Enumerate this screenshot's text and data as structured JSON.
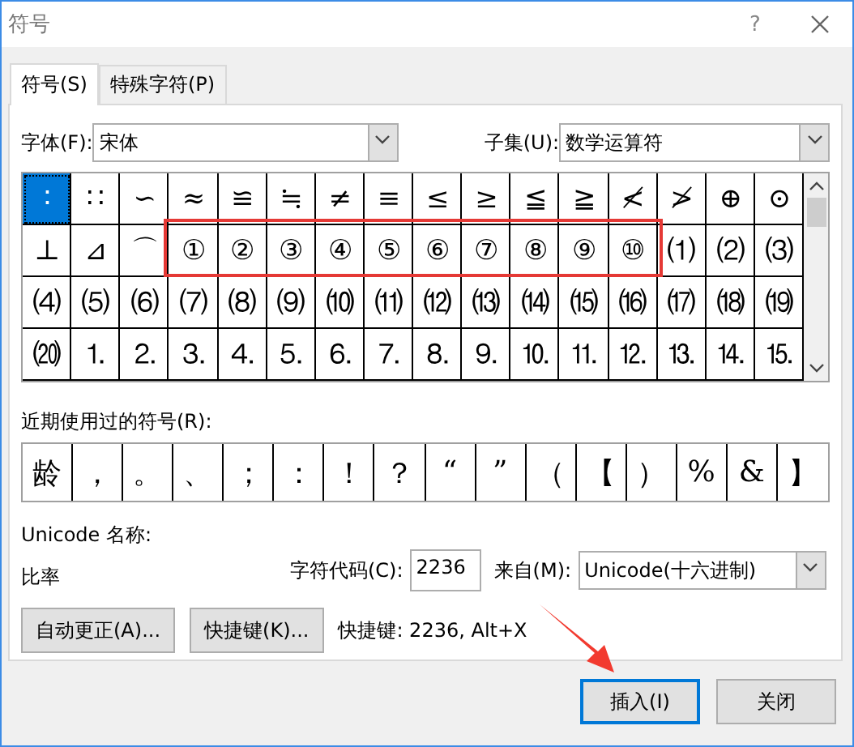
{
  "window": {
    "title": "符号",
    "help": "?"
  },
  "tabs": [
    {
      "label": "符号(S)",
      "selected": true
    },
    {
      "label": "特殊字符(P)",
      "selected": false
    }
  ],
  "font": {
    "label": "字体(F):",
    "value": "宋体"
  },
  "subset": {
    "label": "子集(U):",
    "value": "数学运算符"
  },
  "symbols": [
    [
      {
        "char": "∶",
        "selected": true
      },
      {
        "char": "∷",
        "selected": false
      },
      {
        "char": "∽",
        "selected": false
      },
      {
        "char": "≈",
        "selected": false
      },
      {
        "char": "≌",
        "selected": false
      },
      {
        "char": "≒",
        "selected": false
      },
      {
        "char": "≠",
        "selected": false
      },
      {
        "char": "≡",
        "selected": false
      },
      {
        "char": "≤",
        "selected": false
      },
      {
        "char": "≥",
        "selected": false
      },
      {
        "char": "≦",
        "selected": false
      },
      {
        "char": "≧",
        "selected": false
      },
      {
        "char": "≮",
        "selected": false
      },
      {
        "char": "≯",
        "selected": false
      },
      {
        "char": "⊕",
        "selected": false
      },
      {
        "char": "⊙",
        "selected": false
      }
    ],
    [
      {
        "char": "⊥",
        "selected": false
      },
      {
        "char": "⊿",
        "selected": false
      },
      {
        "char": "⌒",
        "selected": false
      },
      {
        "char": "①",
        "selected": false
      },
      {
        "char": "②",
        "selected": false
      },
      {
        "char": "③",
        "selected": false
      },
      {
        "char": "④",
        "selected": false
      },
      {
        "char": "⑤",
        "selected": false
      },
      {
        "char": "⑥",
        "selected": false
      },
      {
        "char": "⑦",
        "selected": false
      },
      {
        "char": "⑧",
        "selected": false
      },
      {
        "char": "⑨",
        "selected": false
      },
      {
        "char": "⑩",
        "selected": false
      },
      {
        "char": "⑴",
        "selected": false
      },
      {
        "char": "⑵",
        "selected": false
      },
      {
        "char": "⑶",
        "selected": false
      }
    ],
    [
      {
        "char": "⑷",
        "selected": false
      },
      {
        "char": "⑸",
        "selected": false
      },
      {
        "char": "⑹",
        "selected": false
      },
      {
        "char": "⑺",
        "selected": false
      },
      {
        "char": "⑻",
        "selected": false
      },
      {
        "char": "⑼",
        "selected": false
      },
      {
        "char": "⑽",
        "selected": false
      },
      {
        "char": "⑾",
        "selected": false
      },
      {
        "char": "⑿",
        "selected": false
      },
      {
        "char": "⒀",
        "selected": false
      },
      {
        "char": "⒁",
        "selected": false
      },
      {
        "char": "⒂",
        "selected": false
      },
      {
        "char": "⒃",
        "selected": false
      },
      {
        "char": "⒄",
        "selected": false
      },
      {
        "char": "⒅",
        "selected": false
      },
      {
        "char": "⒆",
        "selected": false
      }
    ],
    [
      {
        "char": "⒇",
        "selected": false
      },
      {
        "char": "⒈",
        "selected": false
      },
      {
        "char": "⒉",
        "selected": false
      },
      {
        "char": "⒊",
        "selected": false
      },
      {
        "char": "⒋",
        "selected": false
      },
      {
        "char": "⒌",
        "selected": false
      },
      {
        "char": "⒍",
        "selected": false
      },
      {
        "char": "⒎",
        "selected": false
      },
      {
        "char": "⒏",
        "selected": false
      },
      {
        "char": "⒐",
        "selected": false
      },
      {
        "char": "⒑",
        "selected": false
      },
      {
        "char": "⒒",
        "selected": false
      },
      {
        "char": "⒓",
        "selected": false
      },
      {
        "char": "⒔",
        "selected": false
      },
      {
        "char": "⒕",
        "selected": false
      },
      {
        "char": "⒖",
        "selected": false
      }
    ]
  ],
  "recent": {
    "label": "近期使用过的符号(R):",
    "symbols": [
      "龄",
      "，",
      "。",
      "、",
      "；",
      "：",
      "！",
      "？",
      "“",
      "”",
      "（",
      "【",
      "）",
      "%",
      "&",
      "】"
    ]
  },
  "unicode_name": {
    "label": "Unicode 名称:",
    "value": "比率"
  },
  "char_code": {
    "label": "字符代码(C):",
    "value": "2236"
  },
  "from": {
    "label": "来自(M):",
    "value": "Unicode(十六进制)"
  },
  "actions": [
    "自动更正(A)...",
    "快捷键(K)..."
  ],
  "shortcut": "快捷键: 2236, Alt+X",
  "footer": [
    {
      "label": "插入(I)",
      "default": true
    },
    {
      "label": "关闭",
      "default": false
    }
  ]
}
